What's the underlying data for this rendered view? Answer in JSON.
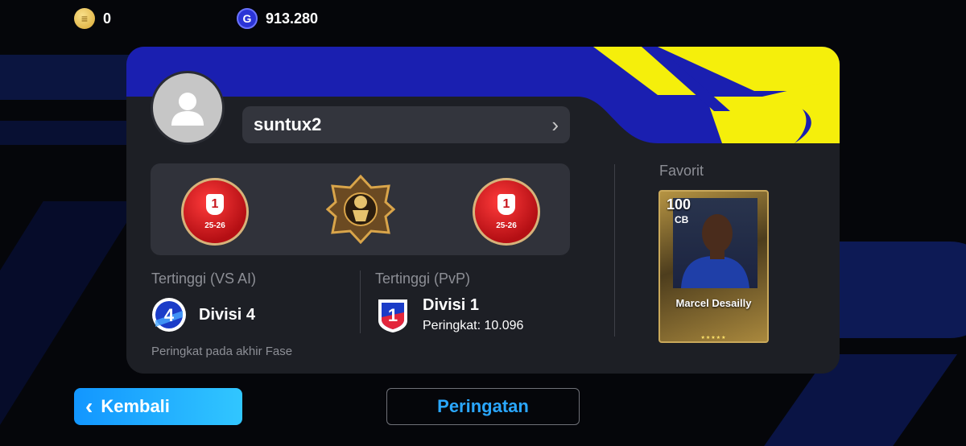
{
  "currency": {
    "coins": "0",
    "gp": "913.280",
    "coin_icon": "coin-icon",
    "gp_icon": "gp-icon"
  },
  "profile": {
    "username": "suntux2",
    "avatar_icon": "user-avatar-icon"
  },
  "achievements": {
    "medal_left": {
      "rank": "1",
      "season": "25-26"
    },
    "medal_right": {
      "rank": "1",
      "season": "25-26"
    }
  },
  "highest_vs_ai": {
    "label": "Tertinggi (VS AI)",
    "badge_number": "4",
    "division": "Divisi 4",
    "note": "Peringkat pada akhir Fase"
  },
  "highest_pvp": {
    "label": "Tertinggi (PvP)",
    "badge_number": "1",
    "division": "Divisi 1",
    "rank_text": "Peringkat: 10.096"
  },
  "favorite": {
    "label": "Favorit",
    "player": {
      "rating": "100",
      "position": "CB",
      "name": "Marcel Desailly",
      "stars": "★★★★★"
    }
  },
  "buttons": {
    "back_label": "Kembali",
    "warning_label": "Peringatan"
  },
  "colors": {
    "accent_blue": "#1a1fb0",
    "accent_yellow": "#f5ef0b",
    "button_blue": "#1296ff",
    "link_blue": "#2aa7ff"
  }
}
